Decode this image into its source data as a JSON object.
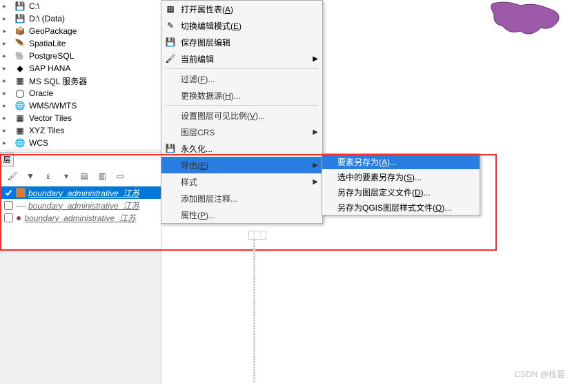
{
  "browser": {
    "items": [
      {
        "icon": "disk",
        "label": "C:\\"
      },
      {
        "icon": "disk",
        "label": "D:\\ (Data)"
      },
      {
        "icon": "gpkg",
        "label": "GeoPackage"
      },
      {
        "icon": "feather",
        "label": "SpatiaLite"
      },
      {
        "icon": "elephant",
        "label": "PostgreSQL"
      },
      {
        "icon": "sap",
        "label": "SAP HANA"
      },
      {
        "icon": "mssql",
        "label": "MS SQL 服务器"
      },
      {
        "icon": "oracle",
        "label": "Oracle"
      },
      {
        "icon": "globe",
        "label": "WMS/WMTS"
      },
      {
        "icon": "grid",
        "label": "Vector Tiles"
      },
      {
        "icon": "grid",
        "label": "XYZ Tiles"
      },
      {
        "icon": "globe",
        "label": "WCS"
      }
    ]
  },
  "layers": {
    "tab_label": "层",
    "items": [
      {
        "name": "boundary_administrative_江苏",
        "selected": true,
        "checked": true,
        "color": "#d97b3c"
      },
      {
        "name": "boundary_administrative_江苏",
        "selected": false,
        "checked": false,
        "color": "#7a7a7a"
      },
      {
        "name": "boundary_administrative_江苏",
        "selected": false,
        "checked": false,
        "color": "#8b3a6b"
      }
    ]
  },
  "contextMenu": {
    "items": [
      {
        "icon": "table",
        "label": "打开属性表",
        "key": "A"
      },
      {
        "icon": "pencil",
        "label": "切换编辑模式",
        "key": "E"
      },
      {
        "icon": "save",
        "label": "保存图层编辑",
        "key": ""
      },
      {
        "icon": "brush",
        "label": "当前编辑",
        "key": "",
        "submenu": true
      },
      {
        "sep": true
      },
      {
        "icon": "",
        "label": "过滤",
        "key": "F",
        "suffix": "..."
      },
      {
        "icon": "",
        "label": "更换数据源",
        "key": "H",
        "suffix": "..."
      },
      {
        "sep": true
      },
      {
        "icon": "",
        "label": "设置图层可见比例",
        "key": "V",
        "suffix": "..."
      },
      {
        "icon": "",
        "label": "图层CRS",
        "key": "",
        "submenu": true
      },
      {
        "icon": "disk2",
        "label": "永久化...",
        "key": ""
      },
      {
        "icon": "",
        "label": "导出",
        "key": "E",
        "submenu": true,
        "highlight": true
      },
      {
        "icon": "",
        "label": "样式",
        "key": "",
        "submenu": true
      },
      {
        "icon": "",
        "label": "添加图层注释...",
        "key": ""
      },
      {
        "icon": "",
        "label": "属性",
        "key": "P",
        "suffix": "..."
      }
    ]
  },
  "submenu": {
    "items": [
      {
        "label": "要素另存为",
        "key": "A",
        "suffix": "...",
        "highlight": true
      },
      {
        "label": "选中的要素另存为",
        "key": "S",
        "suffix": "..."
      },
      {
        "label": "另存为图层定义文件",
        "key": "D",
        "suffix": "..."
      },
      {
        "label": "另存为QGIS图层样式文件",
        "key": "Q",
        "suffix": "..."
      }
    ]
  },
  "watermark": "CSDN @枝昙"
}
